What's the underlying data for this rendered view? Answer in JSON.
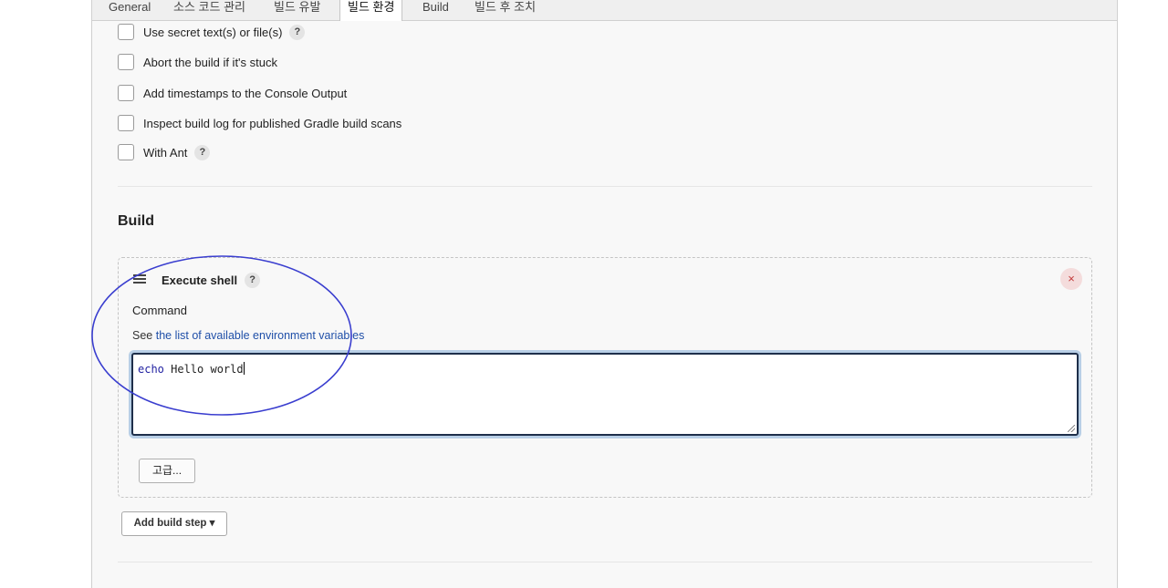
{
  "tabs": [
    "General",
    "소스 코드 관리",
    "빌드 유발",
    "빌드 환경",
    "Build",
    "빌드 후 조치"
  ],
  "active_tab": "빌드 환경",
  "build_env_options": [
    {
      "label": "Use secret text(s) or file(s)",
      "has_help": true
    },
    {
      "label": "Abort the build if it's stuck",
      "has_help": false
    },
    {
      "label": "Add timestamps to the Console Output",
      "has_help": false
    },
    {
      "label": "Inspect build log for published Gradle build scans",
      "has_help": false
    },
    {
      "label": "With Ant",
      "has_help": true
    }
  ],
  "build_section": {
    "title": "Build",
    "step": {
      "title": "Execute shell",
      "help": "?",
      "close": "×",
      "command_label": "Command",
      "see_prefix": "See",
      "see_link": "the list of available environment variables",
      "command_keyword": "echo",
      "command_rest": " Hello world",
      "advanced_button": "고급..."
    },
    "add_step_button": "Add build step",
    "add_step_caret": "▾"
  },
  "colors": {
    "link": "#1f4fa8",
    "annotation_circle": "#3a3ecf",
    "close_button_bg": "#f4dcdc",
    "close_button_fg": "#c23a3a"
  }
}
